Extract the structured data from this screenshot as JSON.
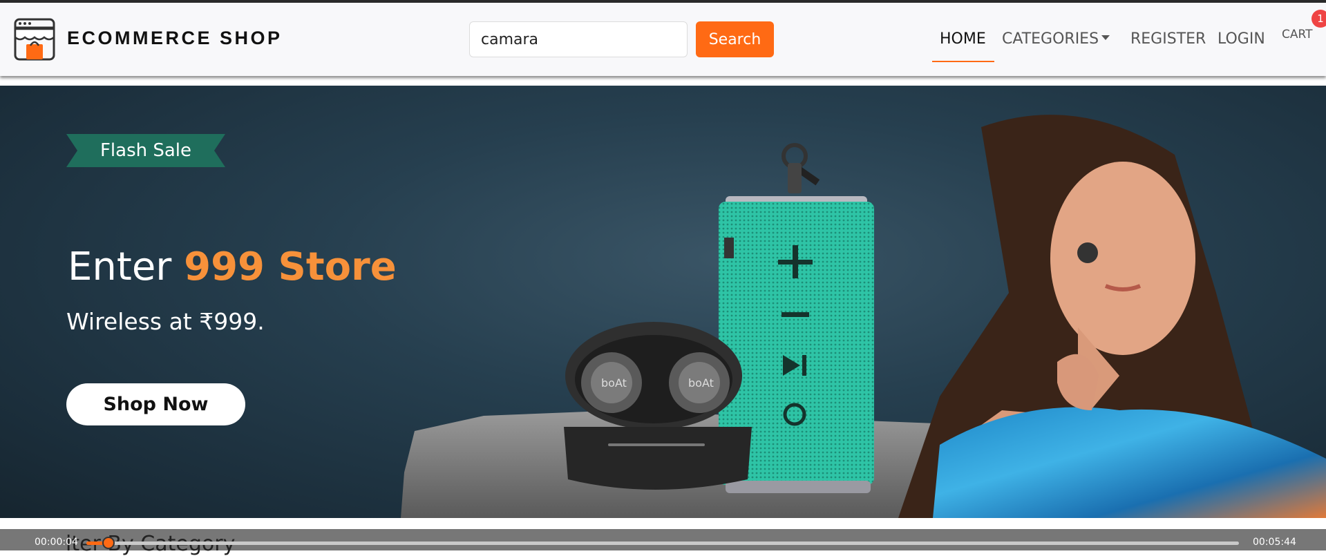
{
  "header": {
    "brand": "ECOMMERCE SHOP",
    "logo_icon": "shop-bag-icon",
    "search": {
      "value": "camara",
      "button_label": "Search"
    },
    "nav": {
      "home": "HOME",
      "categories": "CATEGORIES",
      "register": "REGISTER",
      "login": "LOGIN",
      "cart": "CART",
      "cart_count": "1"
    }
  },
  "hero": {
    "badge": "Flash Sale",
    "headline_prefix": "Enter ",
    "headline_accent": "999 Store",
    "subline": "Wireless at ₹999.",
    "cta": "Shop Now",
    "earbud_brand": "boAt"
  },
  "section": {
    "heading": "lter By Category"
  },
  "video": {
    "current_time": "00:00:04",
    "duration": "00:05:44",
    "progress": 0.012
  },
  "colors": {
    "accent": "#ff6a14",
    "hero_bg": "#263f4f",
    "ribbon": "#1f6e5c",
    "speaker": "#2ec4a6",
    "badge": "#ef4444"
  }
}
